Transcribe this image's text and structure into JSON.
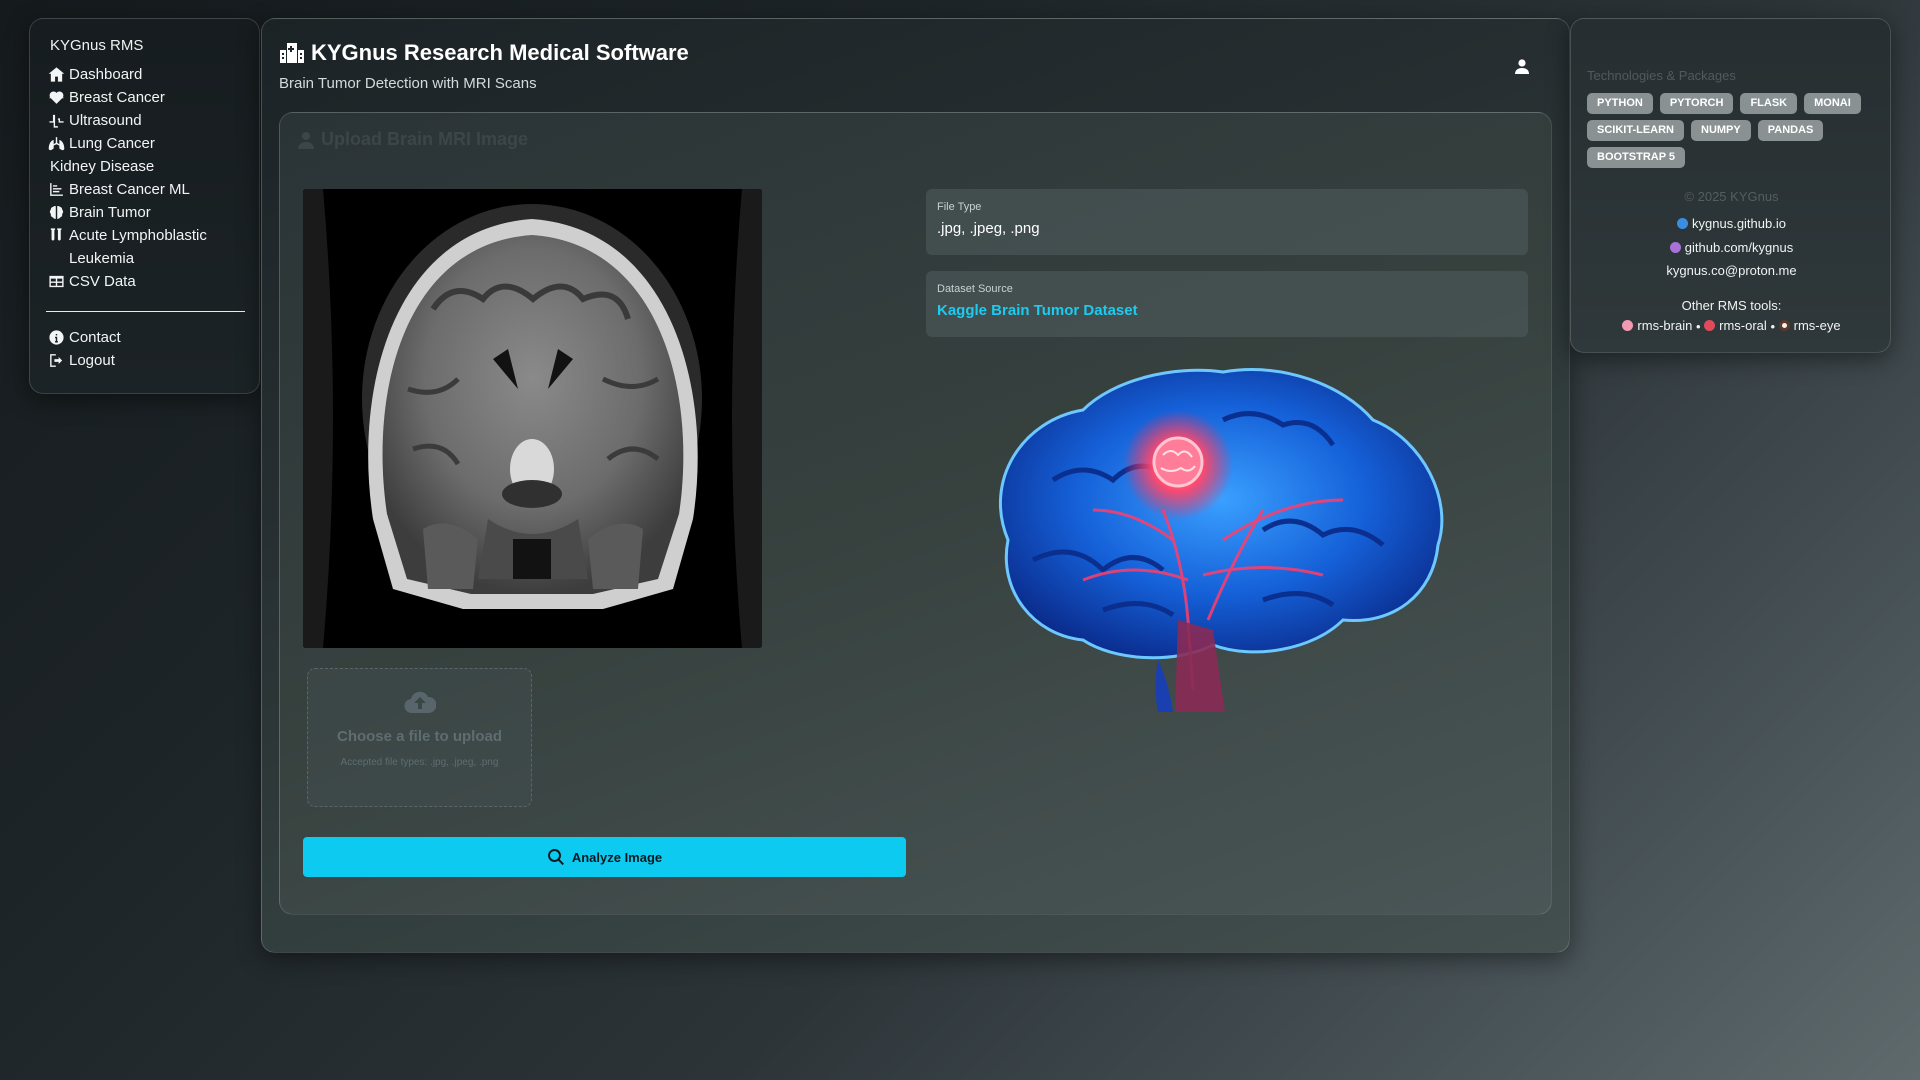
{
  "sidebar": {
    "brand": "KYGnus RMS",
    "items": [
      {
        "label": "Dashboard",
        "icon": "home-icon"
      },
      {
        "label": "Breast Cancer",
        "icon": "heart-pulse-icon"
      },
      {
        "label": "Ultrasound",
        "icon": "wave-icon"
      },
      {
        "label": "Lung Cancer",
        "icon": "lungs-icon"
      },
      {
        "label": "Kidney Disease",
        "icon": ""
      },
      {
        "label": "Breast Cancer ML",
        "icon": "chart-icon"
      },
      {
        "label": "Brain Tumor",
        "icon": "brain-icon"
      },
      {
        "label": "Acute Lymphoblastic Leukemia",
        "icon": "vials-icon"
      },
      {
        "label": "CSV Data",
        "icon": "table-icon"
      }
    ],
    "footer_items": [
      {
        "label": "Contact",
        "icon": "info-icon"
      },
      {
        "label": "Logout",
        "icon": "logout-icon"
      }
    ]
  },
  "header": {
    "title": "KYGnus Research Medical Software",
    "subtitle": "Brain Tumor Detection with MRI Scans"
  },
  "upload_card": {
    "title": "Upload Brain MRI Image",
    "dropzone_title": "Choose a file to upload",
    "dropzone_hint": "Accepted file types: .jpg, .jpeg, .png",
    "analyze_label": "Analyze Image",
    "file_type_label": "File Type",
    "file_type_value": ".jpg, .jpeg, .png",
    "dataset_label": "Dataset Source",
    "dataset_link": "Kaggle Brain Tumor Dataset"
  },
  "right_panel": {
    "tech_heading": "Technologies & Packages",
    "badges": [
      "PYTHON",
      "PYTORCH",
      "FLASK",
      "MONAI",
      "SCIKIT-LEARN",
      "NUMPY",
      "PANDAS",
      "BOOTSTRAP 5"
    ],
    "copyright": "© 2025 KYGnus",
    "website": "kygnus.github.io",
    "github": "github.com/kygnus",
    "email": "kygnus.co@proton.me",
    "other_tools_label": "Other RMS tools:",
    "other_tools": [
      "rms-brain",
      "rms-oral",
      "rms-eye"
    ],
    "separator": "•"
  },
  "colors": {
    "accent": "#0dcaf0",
    "link": "#1ccbf0",
    "badge": "#8a9193"
  }
}
